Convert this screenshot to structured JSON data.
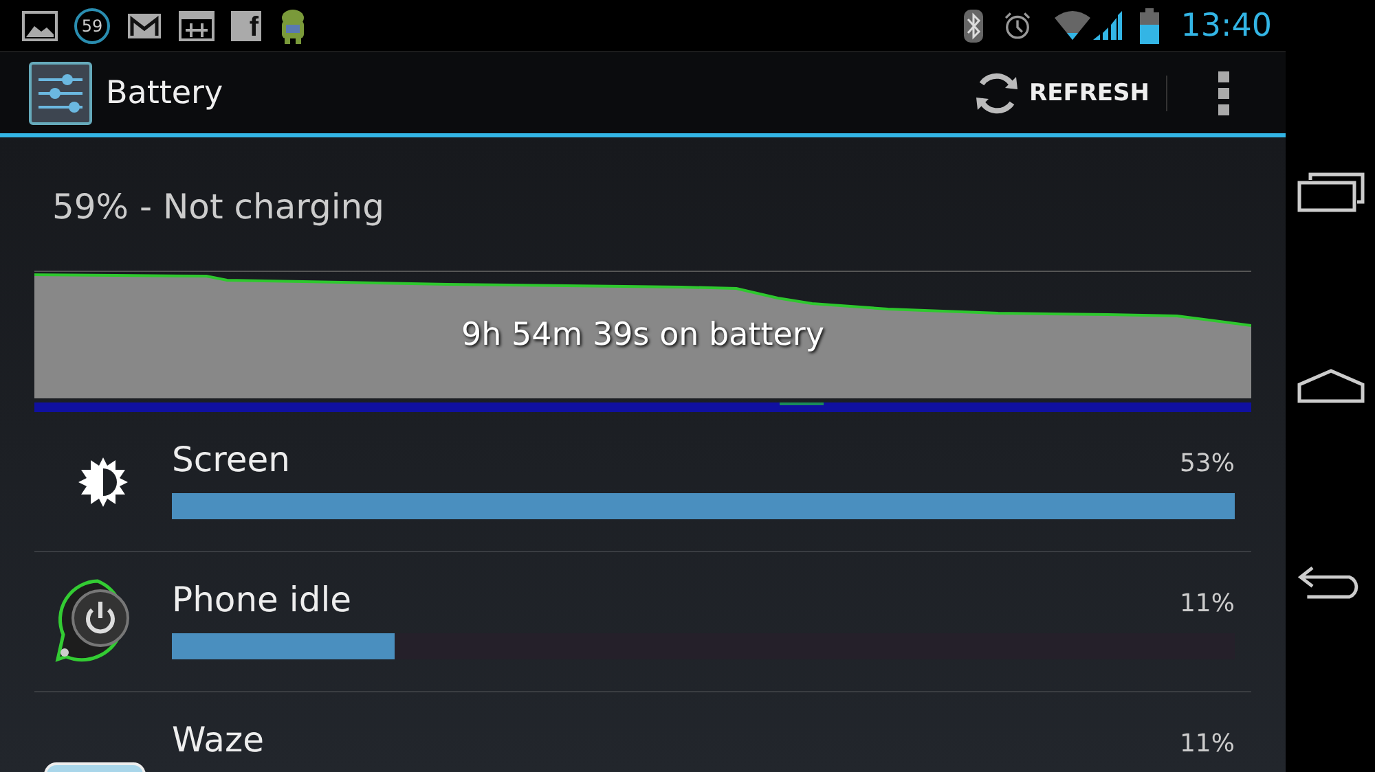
{
  "status_bar": {
    "notifications": [
      {
        "kind": "gallery"
      },
      {
        "kind": "counter",
        "text": "59"
      },
      {
        "kind": "mail"
      },
      {
        "kind": "calendar"
      },
      {
        "kind": "social",
        "text": "f"
      },
      {
        "kind": "robot"
      }
    ],
    "time": "13:40"
  },
  "action_bar": {
    "title": "Battery",
    "action": "REFRESH"
  },
  "summary": "59% - Not charging",
  "graph": {
    "label": "9h 54m 39s on battery"
  },
  "items": [
    {
      "kind": "screen",
      "name": "Screen",
      "percent": "53%",
      "level": 1
    },
    {
      "kind": "idle",
      "name": "Phone idle",
      "percent": "11%",
      "level": 0.21
    },
    {
      "kind": "app",
      "name": "Waze",
      "percent": "11%"
    }
  ]
}
